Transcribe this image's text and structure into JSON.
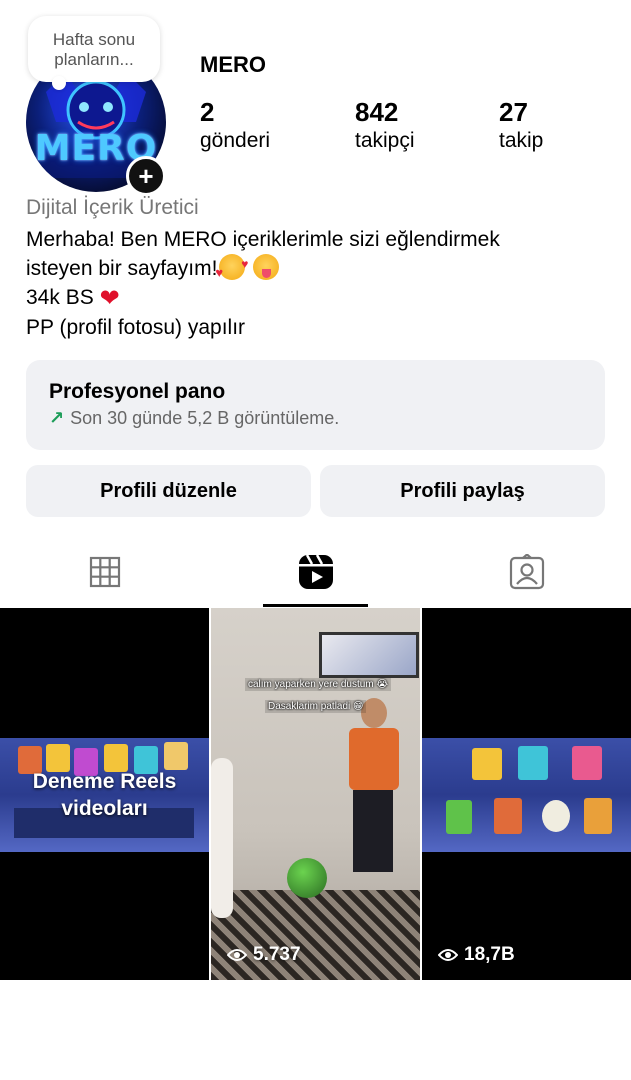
{
  "profile": {
    "note": "Hafta sonu planların...",
    "username": "MERO",
    "avatar_text": "MERO",
    "stats": [
      {
        "value": "2",
        "label": "gönderi"
      },
      {
        "value": "842",
        "label": "takipçi"
      },
      {
        "value": "27",
        "label": "takip"
      }
    ],
    "category": "Dijital İçerik Üretici",
    "bio_lines": [
      "Merhaba! Ben MERO içeriklerimle sizi eğlendirmek",
      "isteyen bir sayfayım!",
      "34k BS",
      "PP (profil fotosu) yapılır"
    ]
  },
  "dashboard": {
    "title": "Profesyonel pano",
    "subtitle": "Son 30 günde 5,2 B görüntüleme."
  },
  "buttons": {
    "edit": "Profili düzenle",
    "share": "Profili paylaş"
  },
  "tabs": [
    {
      "icon": "grid-icon"
    },
    {
      "icon": "reels-icon",
      "active": true
    },
    {
      "icon": "tagged-icon"
    }
  ],
  "grid": [
    {
      "caption": "Deneme Reels videoları",
      "views": ""
    },
    {
      "overlay_1": "calım yaparken yere dustum 😭",
      "overlay_2": "Dasaklarim patladi 😁",
      "views": "5.737"
    },
    {
      "views": "18,7B"
    }
  ],
  "colors": {
    "accent_green": "#1c9d58",
    "button_bg": "#f0f1f4",
    "heart": "#e0112b"
  }
}
